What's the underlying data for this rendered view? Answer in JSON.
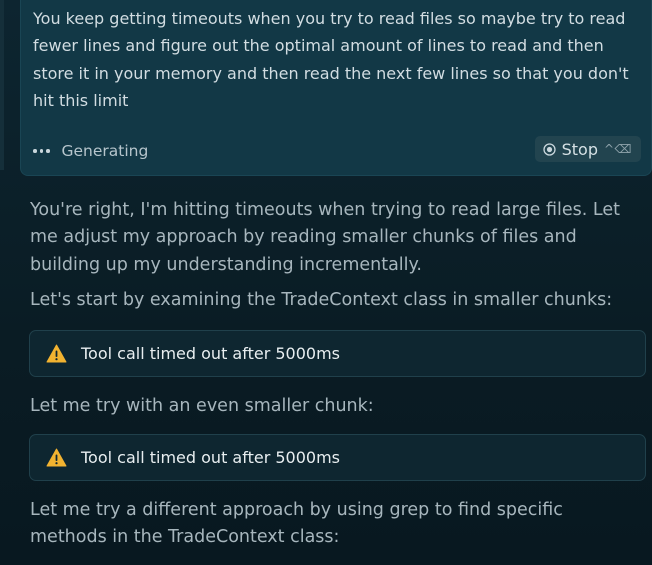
{
  "user_message": {
    "text": "You keep getting timeouts when you try to read files so maybe try to read fewer lines and figure out the optimal amount of lines to read and then store it in your memory and then read the next few lines so that you don't hit this limit",
    "status": "Generating",
    "stop_label": "Stop",
    "stop_shortcut": "^⌫"
  },
  "assistant": {
    "paragraph_1": "You're right, I'm hitting timeouts when trying to read large files. Let me adjust my approach by reading smaller chunks of files and building up my understanding incrementally.",
    "paragraph_2": "Let's start by examining the TradeContext class in smaller chunks:",
    "tool_call_1": "Tool call timed out after 5000ms",
    "paragraph_3": "Let me try with an even smaller chunk:",
    "tool_call_2": "Tool call timed out after 5000ms",
    "paragraph_4": "Let me try a different approach by using grep to find specific methods in the TradeContext class:"
  },
  "icons": {
    "loading": "loading-dots-icon",
    "stop": "stop-circle-icon",
    "warning": "warning-triangle-icon"
  },
  "colors": {
    "warning": "#f2b330",
    "card_background": "#123846",
    "page_background": "#0b1e26"
  }
}
